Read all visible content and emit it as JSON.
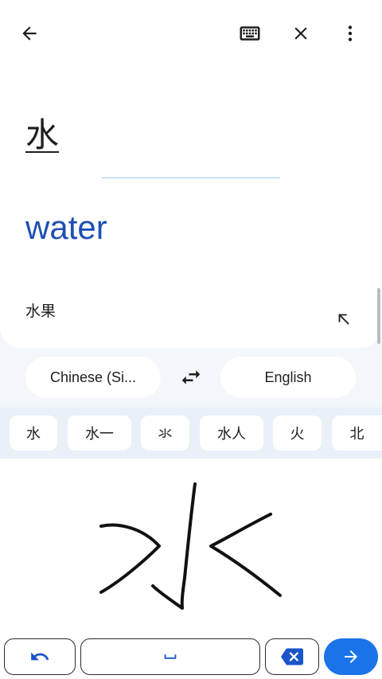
{
  "topbar": {
    "back_icon": "arrow-left-icon",
    "keyboard_icon": "keyboard-icon",
    "close_icon": "close-icon",
    "more_icon": "more-vert-icon"
  },
  "input": {
    "source_text": "水"
  },
  "output": {
    "translation": "water",
    "suggestion": "水果",
    "insert_icon": "arrow-up-left-icon"
  },
  "languages": {
    "source": "Chinese (Si...",
    "target": "English",
    "swap_icon": "swap-horiz-icon"
  },
  "candidates": [
    "水",
    "水一",
    "氺",
    "水人",
    "火",
    "北"
  ],
  "keyboard": {
    "undo_icon": "undo-icon",
    "space_icon": "space-bar-icon",
    "backspace_icon": "backspace-icon",
    "enter_icon": "arrow-right-icon"
  },
  "colors": {
    "accent": "#1a73e8",
    "translation_text": "#1f4fb5",
    "background": "#f3f6fb"
  }
}
